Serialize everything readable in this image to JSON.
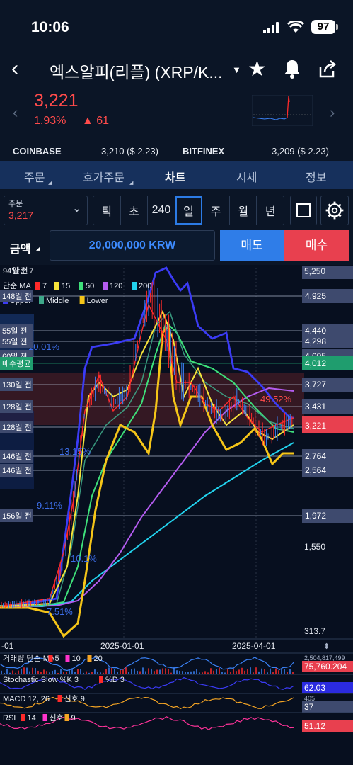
{
  "status_bar": {
    "time": "10:06",
    "battery": "97"
  },
  "header": {
    "title": "엑스알피(리플) (XRP/K...",
    "price": "3,221",
    "change_pct": "1.93%",
    "change_abs": "▲ 61"
  },
  "exchanges": [
    {
      "name": "COINBASE",
      "value": "3,210 ($ 2.23)"
    },
    {
      "name": "BITFINEX",
      "value": "3,209 ($ 2.23)"
    }
  ],
  "tabs": [
    {
      "label": "주문",
      "active": false,
      "has_menu": true
    },
    {
      "label": "호가주문",
      "active": false,
      "has_menu": true
    },
    {
      "label": "차트",
      "active": true,
      "has_menu": false
    },
    {
      "label": "시세",
      "active": false,
      "has_menu": false
    },
    {
      "label": "정보",
      "active": false,
      "has_menu": false
    }
  ],
  "order": {
    "label": "주문",
    "value": "3,217"
  },
  "periods": [
    "틱",
    "초",
    "240",
    "일",
    "주",
    "월",
    "년"
  ],
  "selected_period": "일",
  "amount": {
    "label": "금액",
    "value": "20,000,000 KRW"
  },
  "actions": {
    "sell": "매도",
    "buy": "매수"
  },
  "chart": {
    "legend_top": "94일 전",
    "legend_overlap": "단순 7",
    "ma_label": "단순 MA",
    "ma_items": [
      {
        "label": "7",
        "color": "#ff2a2a"
      },
      {
        "label": "15",
        "color": "#f5e33b"
      },
      {
        "label": "50",
        "color": "#3ee07a"
      },
      {
        "label": "120",
        "color": "#b45cf0"
      },
      {
        "label": "200",
        "color": "#22d3ee"
      }
    ],
    "bb_items": [
      {
        "label": "Upper",
        "color": "#3b3bf5"
      },
      {
        "label": "Middle",
        "color": "#3ea88a"
      },
      {
        "label": "Lower",
        "color": "#f5c518"
      }
    ],
    "hline_labels": [
      {
        "text": "148일 전",
        "price": "4,925"
      },
      {
        "text": "55일 전",
        "price": "4,440"
      },
      {
        "text": "55일 전",
        "price": "4,298"
      },
      {
        "text": "60일 전",
        "price": "4,095"
      },
      {
        "text": "매수평균",
        "price": "4,012"
      },
      {
        "text": "130일 전",
        "price": "3,727"
      },
      {
        "text": "128일 전",
        "price": "3,431"
      },
      {
        "text": "128일 전",
        "price": "3,218"
      },
      {
        "text": "146일 전",
        "price": "2,764"
      },
      {
        "text": "146일 전",
        "price": "2,564"
      },
      {
        "text": "156일 전",
        "price": "1,972"
      }
    ],
    "axis_labels": [
      "5,250",
      "1,550",
      "313.7"
    ],
    "pct_labels": [
      "10.01%",
      "49.52%",
      "13.15%",
      "9.11%",
      "10.1%",
      "7.51%"
    ],
    "x_labels": [
      "-01",
      "2025-01-01",
      "2025-04-01"
    ],
    "indicators": [
      {
        "name": "거래량 단순 MA",
        "items": [
          "5",
          "10",
          "20"
        ],
        "axis": "2,504,817,499",
        "value": "75,760.204"
      },
      {
        "name": "Stochastic Slow %K 3",
        "items": [
          "%D 3"
        ],
        "axis": "",
        "value": "62.03"
      },
      {
        "name": "MACD 12, 26",
        "items": [
          "신호 9"
        ],
        "axis": "405",
        "value": "37"
      },
      {
        "name": "RSI",
        "items": [
          "14",
          "신호",
          "9"
        ],
        "axis": "",
        "value": "51.12"
      }
    ],
    "colors": {
      "current": "#e8404f",
      "buy_avg": "#1f9d6e",
      "candle_up": "#ff2a2a",
      "candle_down": "#3b82f6"
    }
  }
}
